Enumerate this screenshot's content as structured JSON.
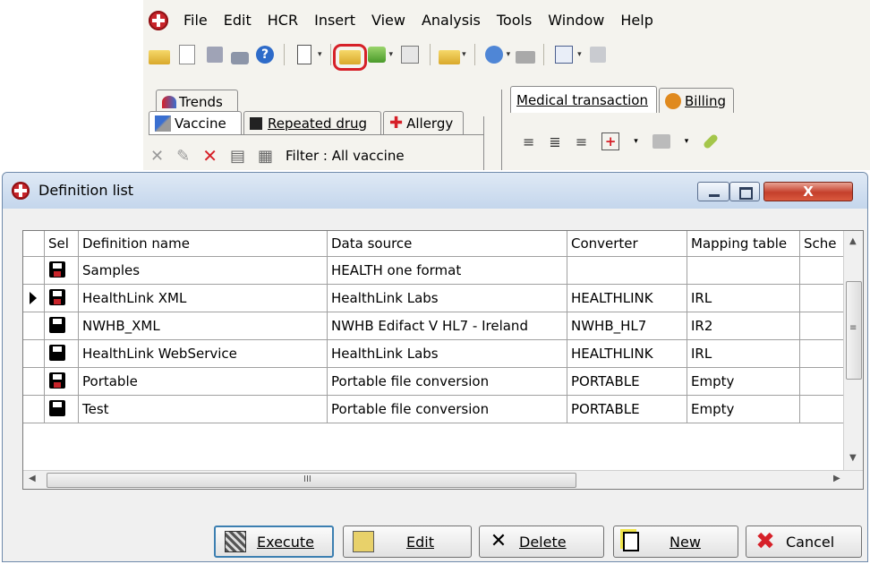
{
  "app": {
    "menu": [
      "File",
      "Edit",
      "HCR",
      "Insert",
      "View",
      "Analysis",
      "Tools",
      "Window",
      "Help"
    ],
    "tabs_top": {
      "trends": "Trends",
      "medical_transaction": "Medical transaction",
      "billing": "Billing"
    },
    "tabs_sub": {
      "vaccine": "Vaccine",
      "repeated_drug": "Repeated drug",
      "allergy": "Allergy"
    },
    "filter_label": "Filter : All vaccine"
  },
  "dialog": {
    "title": "Definition list",
    "close_glyph": "X",
    "columns": [
      "Sel",
      "Definition name",
      "Data source",
      "Converter",
      "Mapping table",
      "Sche"
    ],
    "rows": [
      {
        "name": "Samples",
        "source": "HEALTH one format",
        "converter": "",
        "mapping": "",
        "selected": false
      },
      {
        "name": "HealthLink XML",
        "source": "HealthLink Labs",
        "converter": "HEALTHLINK",
        "mapping": "IRL",
        "selected": true
      },
      {
        "name": "NWHB_XML",
        "source": "NWHB Edifact V HL7 - Ireland",
        "converter": "NWHB_HL7",
        "mapping": "IR2",
        "selected": false
      },
      {
        "name": "HealthLink WebService",
        "source": "HealthLink Labs",
        "converter": "HEALTHLINK",
        "mapping": "IRL",
        "selected": false
      },
      {
        "name": "Portable",
        "source": "Portable file conversion",
        "converter": "PORTABLE",
        "mapping": "Empty",
        "selected": false
      },
      {
        "name": "Test",
        "source": "Portable file conversion",
        "converter": "PORTABLE",
        "mapping": "Empty",
        "selected": false
      }
    ],
    "hscroll_grip": "III",
    "vscroll_grip": "≡",
    "buttons": {
      "execute": "Execute",
      "edit": "Edit",
      "delete": "Delete",
      "new": "New",
      "cancel": "Cancel"
    }
  },
  "icons": {
    "delete_glyph": "✕",
    "cancel_glyph": "✖",
    "help_glyph": "?"
  }
}
